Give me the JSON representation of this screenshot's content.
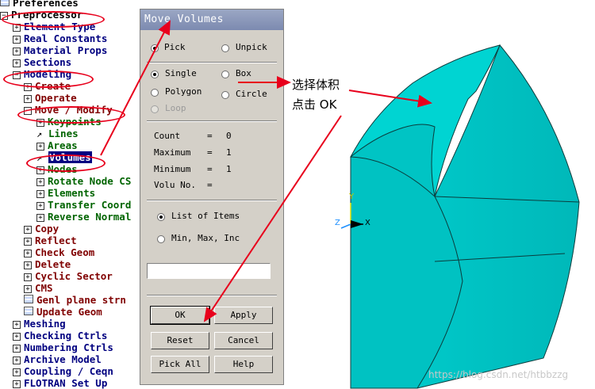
{
  "tree": [
    {
      "text": "Preferences",
      "level": 0,
      "marker": "icon",
      "color": "black"
    },
    {
      "text": "Preprocessor",
      "level": 0,
      "marker": "minus",
      "color": "black"
    },
    {
      "text": "Element Type",
      "level": 1,
      "marker": "plus",
      "color": "navy"
    },
    {
      "text": "Real Constants",
      "level": 1,
      "marker": "plus",
      "color": "navy"
    },
    {
      "text": "Material Props",
      "level": 1,
      "marker": "plus",
      "color": "navy"
    },
    {
      "text": "Sections",
      "level": 1,
      "marker": "plus",
      "color": "navy"
    },
    {
      "text": "Modeling",
      "level": 1,
      "marker": "minus",
      "color": "navy"
    },
    {
      "text": "Create",
      "level": 2,
      "marker": "plus",
      "color": "red"
    },
    {
      "text": "Operate",
      "level": 2,
      "marker": "plus",
      "color": "red"
    },
    {
      "text": "Move / Modify",
      "level": 2,
      "marker": "minus",
      "color": "red"
    },
    {
      "text": "Keypoints",
      "level": 3,
      "marker": "plus",
      "color": "green"
    },
    {
      "text": "Lines",
      "level": 3,
      "marker": "pick",
      "color": "green"
    },
    {
      "text": "Areas",
      "level": 3,
      "marker": "plus",
      "color": "green"
    },
    {
      "text": "Volumes",
      "level": 3,
      "marker": "pick",
      "color": "green",
      "selected": true
    },
    {
      "text": "Nodes",
      "level": 3,
      "marker": "plus",
      "color": "green"
    },
    {
      "text": "Rotate Node CS",
      "level": 3,
      "marker": "plus",
      "color": "green"
    },
    {
      "text": "Elements",
      "level": 3,
      "marker": "plus",
      "color": "green"
    },
    {
      "text": "Transfer Coord",
      "level": 3,
      "marker": "plus",
      "color": "green"
    },
    {
      "text": "Reverse Normal",
      "level": 3,
      "marker": "plus",
      "color": "green"
    },
    {
      "text": "Copy",
      "level": 2,
      "marker": "plus",
      "color": "red"
    },
    {
      "text": "Reflect",
      "level": 2,
      "marker": "plus",
      "color": "red"
    },
    {
      "text": "Check Geom",
      "level": 2,
      "marker": "plus",
      "color": "red"
    },
    {
      "text": "Delete",
      "level": 2,
      "marker": "plus",
      "color": "red"
    },
    {
      "text": "Cyclic Sector",
      "level": 2,
      "marker": "plus",
      "color": "red"
    },
    {
      "text": "CMS",
      "level": 2,
      "marker": "plus",
      "color": "red"
    },
    {
      "text": "Genl plane strn",
      "level": 2,
      "marker": "icon",
      "color": "red"
    },
    {
      "text": "Update Geom",
      "level": 2,
      "marker": "icon",
      "color": "red"
    },
    {
      "text": "Meshing",
      "level": 1,
      "marker": "plus",
      "color": "navy"
    },
    {
      "text": "Checking Ctrls",
      "level": 1,
      "marker": "plus",
      "color": "navy"
    },
    {
      "text": "Numbering Ctrls",
      "level": 1,
      "marker": "plus",
      "color": "navy"
    },
    {
      "text": "Archive Model",
      "level": 1,
      "marker": "plus",
      "color": "navy"
    },
    {
      "text": "Coupling / Ceqn",
      "level": 1,
      "marker": "plus",
      "color": "navy"
    },
    {
      "text": "FLOTRAN Set Up",
      "level": 1,
      "marker": "plus",
      "color": "navy"
    }
  ],
  "dialog": {
    "title": "Move Volumes",
    "pick_mode": {
      "pick": "Pick",
      "unpick": "Unpick",
      "selected": "pick"
    },
    "shape": {
      "single": "Single",
      "box": "Box",
      "polygon": "Polygon",
      "circle": "Circle",
      "loop": "Loop",
      "selected": "single"
    },
    "info": {
      "count_label": "Count",
      "count_eq": "=",
      "count_value": "0",
      "max_label": "Maximum",
      "max_eq": "=",
      "max_value": "1",
      "min_label": "Minimum",
      "min_eq": "=",
      "min_value": "1",
      "volu_label": "Volu No.",
      "volu_eq": "="
    },
    "entry": {
      "list_items": "List of Items",
      "min_max_inc": "Min, Max, Inc",
      "selected": "list_items",
      "value": ""
    },
    "buttons": {
      "ok": "OK",
      "apply": "Apply",
      "reset": "Reset",
      "cancel": "Cancel",
      "pick_all": "Pick All",
      "help": "Help"
    }
  },
  "annotation": {
    "line1": "选择体积",
    "line2": "点击 OK",
    "color": "#e8001c"
  },
  "triad": {
    "y": "Y",
    "z": "Z",
    "x": "X"
  },
  "watermark": "https://blog.csdn.net/htbbzzg",
  "colors": {
    "model": "#00c8c8",
    "model_dark": "#00a6a8",
    "edge": "#0b3c3c",
    "highlight": "#e8001c",
    "selection": "#000080"
  }
}
